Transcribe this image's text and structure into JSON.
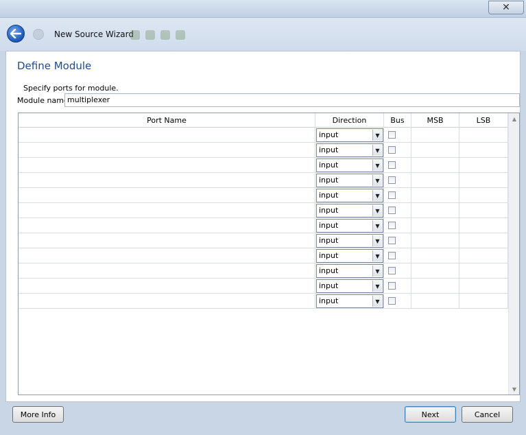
{
  "window": {
    "close_glyph": "✕"
  },
  "toolbar": {
    "title": "New Source Wizard",
    "back_glyph": "➜"
  },
  "page": {
    "heading": "Define Module",
    "instructions": "Specify ports for module.",
    "module_name_label": "Module name",
    "module_name_value": "multiplexer"
  },
  "table": {
    "headers": {
      "port_name": "Port Name",
      "direction": "Direction",
      "bus": "Bus",
      "msb": "MSB",
      "lsb": "LSB"
    },
    "rows": [
      {
        "port_name": "",
        "direction": "input",
        "bus": false,
        "msb": "",
        "lsb": ""
      },
      {
        "port_name": "",
        "direction": "input",
        "bus": false,
        "msb": "",
        "lsb": ""
      },
      {
        "port_name": "",
        "direction": "input",
        "bus": false,
        "msb": "",
        "lsb": ""
      },
      {
        "port_name": "",
        "direction": "input",
        "bus": false,
        "msb": "",
        "lsb": ""
      },
      {
        "port_name": "",
        "direction": "input",
        "bus": false,
        "msb": "",
        "lsb": ""
      },
      {
        "port_name": "",
        "direction": "input",
        "bus": false,
        "msb": "",
        "lsb": ""
      },
      {
        "port_name": "",
        "direction": "input",
        "bus": false,
        "msb": "",
        "lsb": ""
      },
      {
        "port_name": "",
        "direction": "input",
        "bus": false,
        "msb": "",
        "lsb": ""
      },
      {
        "port_name": "",
        "direction": "input",
        "bus": false,
        "msb": "",
        "lsb": ""
      },
      {
        "port_name": "",
        "direction": "input",
        "bus": false,
        "msb": "",
        "lsb": ""
      },
      {
        "port_name": "",
        "direction": "input",
        "bus": false,
        "msb": "",
        "lsb": ""
      },
      {
        "port_name": "",
        "direction": "input",
        "bus": false,
        "msb": "",
        "lsb": ""
      }
    ]
  },
  "buttons": {
    "more_info": "More Info",
    "next": "Next",
    "cancel": "Cancel"
  },
  "icons": {
    "back": "back-arrow-icon",
    "close": "close-icon",
    "dropdown": "chevron-down-icon"
  },
  "colors": {
    "heading": "#1f4a8c",
    "back_button": "#1c56b8"
  }
}
